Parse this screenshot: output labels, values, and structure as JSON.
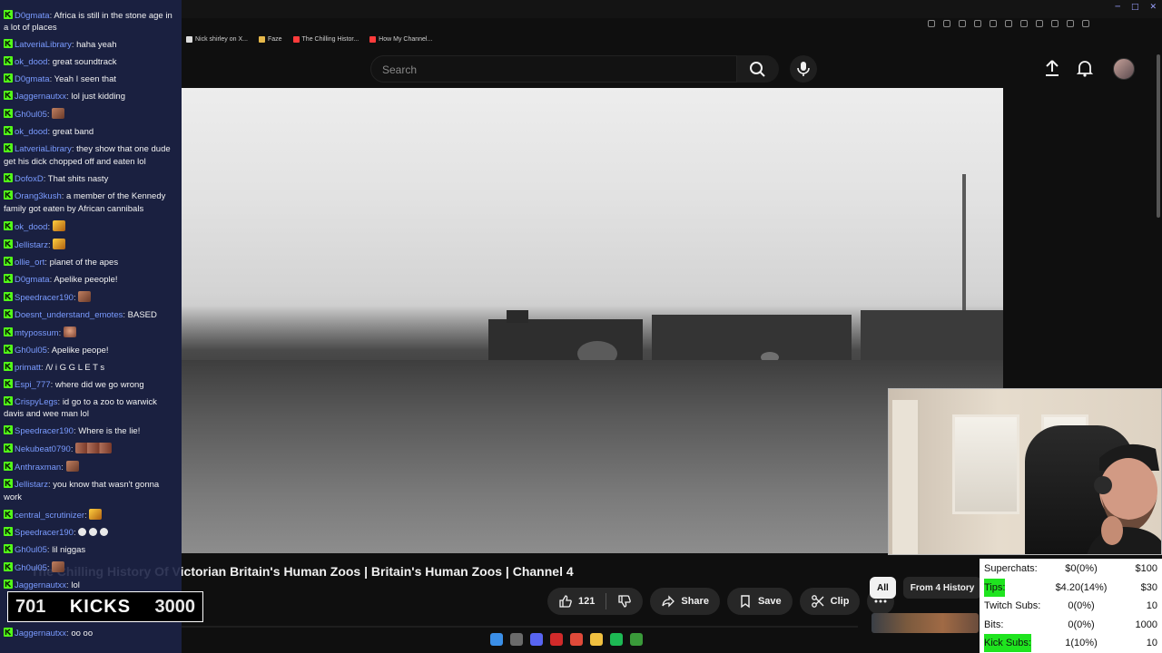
{
  "browser": {
    "bookmarks": [
      {
        "label": "Nick shirley on X...",
        "color": "#dddddd"
      },
      {
        "label": "Faze",
        "color": "#e6b84a"
      },
      {
        "label": "The Chilling Histor...",
        "color": "#ff3b3b"
      },
      {
        "label": "How My Channel...",
        "color": "#ff3b3b"
      }
    ]
  },
  "youtube": {
    "search_placeholder": "Search",
    "video_title": "The Chilling History Of Victorian Britain's Human Zoos | Britain's Human Zoos | Channel 4",
    "like_count": "121",
    "share_label": "Share",
    "save_label": "Save",
    "clip_label": "Clip",
    "chips": [
      "All",
      "From 4 History"
    ]
  },
  "chat": [
    {
      "user": "D0gmata",
      "text": "Africa is still in the stone age in a lot of places"
    },
    {
      "user": "LatveriaLibrary",
      "text": "haha yeah"
    },
    {
      "user": "ok_dood",
      "text": "great soundtrack"
    },
    {
      "user": "D0gmata",
      "text": "Yeah I seen that"
    },
    {
      "user": "Jaggernautxx",
      "text": "lol just kidding"
    },
    {
      "user": "Gh0ul05",
      "text": "",
      "emote": "e-brown"
    },
    {
      "user": "ok_dood",
      "text": "great band"
    },
    {
      "user": "LatveriaLibrary",
      "text": "they show that one dude get his dick chopped off and eaten lol"
    },
    {
      "user": "DofoxD",
      "text": "That shits nasty"
    },
    {
      "user": "Orang3kush",
      "text": "a member of the Kennedy family got eaten by African cannibals"
    },
    {
      "user": "ok_dood",
      "text": "",
      "emote": "e-yellow"
    },
    {
      "user": "Jellistarz",
      "text": "",
      "emote": "e-yellow"
    },
    {
      "user": "ollie_ort",
      "text": "planet of the apes"
    },
    {
      "user": "D0gmata",
      "text": "Apelike peeople!"
    },
    {
      "user": "Speedracer190",
      "text": "",
      "emote": "e-brown"
    },
    {
      "user": "Doesnt_understand_emotes",
      "text": "BASED"
    },
    {
      "user": "mtypossum",
      "text": "",
      "emote": "e-face"
    },
    {
      "user": "Gh0ul05",
      "text": "Apelike peope!"
    },
    {
      "user": "primatt",
      "text": "/\\/ i G G L E T s"
    },
    {
      "user": "Espi_777",
      "text": "where did we go wrong"
    },
    {
      "user": "CrispyLegs",
      "text": "id go to a zoo to warwick davis and wee man lol"
    },
    {
      "user": "Speedracer190",
      "text": "Where is the lie!"
    },
    {
      "user": "Nekubeat0790",
      "text": "",
      "emote": "e-group"
    },
    {
      "user": "Anthraxman",
      "text": "",
      "emote": "e-brown"
    },
    {
      "user": "Jellistarz",
      "text": "you know that wasn't gonna work"
    },
    {
      "user": "central_scrutinizer",
      "text": "",
      "emote": "e-yellow"
    },
    {
      "user": "Speedracer190",
      "text": "",
      "emote": "dots"
    },
    {
      "user": "Gh0ul05",
      "text": "lil niggas"
    },
    {
      "user": "Gh0ul05",
      "text": "",
      "emote": "e-brown"
    },
    {
      "user": "Jaggernautxx",
      "text": "lol"
    },
    {
      "user": "",
      "text": ""
    },
    {
      "user": "",
      "text": ""
    },
    {
      "user": "Jaggernautxx",
      "text": "oo oo"
    }
  ],
  "kicks": {
    "count": "701",
    "label": "KICKS",
    "goal": "3000"
  },
  "stats": [
    {
      "label": "Superchats:",
      "value": "$0(0%)",
      "goal": "$100",
      "highlight": false
    },
    {
      "label": "Tips:",
      "value": "$4.20(14%)",
      "goal": "$30",
      "highlight": true
    },
    {
      "label": "Twitch Subs:",
      "value": "0(0%)",
      "goal": "10",
      "highlight": false
    },
    {
      "label": "Bits:",
      "value": "0(0%)",
      "goal": "1000",
      "highlight": false
    },
    {
      "label": "Kick Subs:",
      "value": "1(10%)",
      "goal": "10",
      "highlight": true
    }
  ],
  "colors": {
    "chat_bg": "#1c2246",
    "username": "#7a9bff",
    "kick_green": "#53fc18",
    "stat_highlight": "#1fe41f",
    "yt_bg": "#0f0f0f"
  }
}
